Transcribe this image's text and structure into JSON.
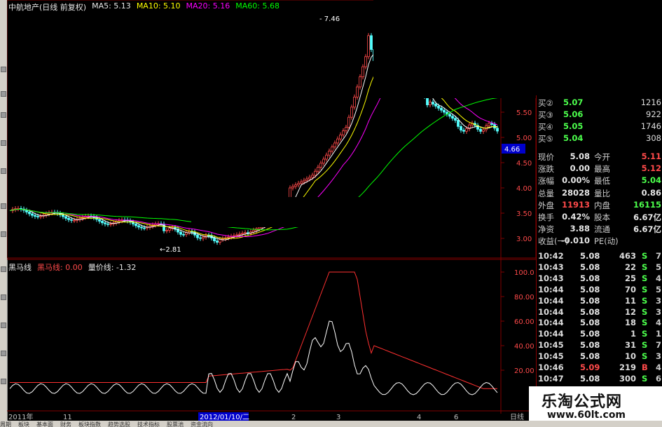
{
  "title": {
    "stock": "中航地产(日线 前复权)",
    "ma5": "MA5: 5.13",
    "ma10": "MA10: 5.10",
    "ma20": "MA20: 5.16",
    "ma60": "MA60: 5.68"
  },
  "indicator": {
    "name": "黑马线",
    "heima": "黑马线: 0.00",
    "liangjia": "量价线: -1.32"
  },
  "price_axis": [
    "5.50",
    "5.00",
    "4.50",
    "4.00",
    "3.50",
    "3.00"
  ],
  "current_price_tag": "4.66",
  "indicator_axis": [
    "100.0",
    "80.00",
    "60.00",
    "40.00",
    "20.00"
  ],
  "annotations": {
    "high": "7.46",
    "low": "2.81"
  },
  "x_labels": {
    "year": "2011年",
    "m11": "11",
    "cursor_date": "2012/01/10/二",
    "m2": "2",
    "m3": "3",
    "m4": "4",
    "m6": "6",
    "period": "日线"
  },
  "order_book": [
    {
      "label": "买②",
      "price": "5.07",
      "vol": "1216"
    },
    {
      "label": "买③",
      "price": "5.06",
      "vol": "922"
    },
    {
      "label": "买④",
      "price": "5.05",
      "vol": "1746"
    },
    {
      "label": "买⑤",
      "price": "5.04",
      "vol": "308"
    }
  ],
  "stats": [
    {
      "l1": "现价",
      "v1": "5.08",
      "c1": "#e6e6e6",
      "l2": "今开",
      "v2": "5.11",
      "c2": "#ff4a4a"
    },
    {
      "l1": "涨跌",
      "v1": "0.00",
      "c1": "#e6e6e6",
      "l2": "最高",
      "v2": "5.12",
      "c2": "#ff4a4a"
    },
    {
      "l1": "涨幅",
      "v1": "0.00%",
      "c1": "#e6e6e6",
      "l2": "最低",
      "v2": "5.04",
      "c2": "#4cff4c"
    },
    {
      "l1": "总量",
      "v1": "28028",
      "c1": "#e6e6e6",
      "l2": "量比",
      "v2": "0.86",
      "c2": "#e6e6e6"
    },
    {
      "l1": "外盘",
      "v1": "11913",
      "c1": "#ff4a4a",
      "l2": "内盘",
      "v2": "16115",
      "c2": "#4cff4c"
    },
    {
      "l1": "换手",
      "v1": "0.42%",
      "c1": "#e6e6e6",
      "l2": "股本",
      "v2": "6.67亿",
      "c2": "#e6e6e6"
    },
    {
      "l1": "净资",
      "v1": "3.88",
      "c1": "#e6e6e6",
      "l2": "流通",
      "v2": "6.67亿",
      "c2": "#e6e6e6"
    },
    {
      "l1": "收益(一)",
      "v1": "-0.010",
      "c1": "#e6e6e6",
      "l2": "PE(动)",
      "v2": "",
      "c2": "#e6e6e6"
    }
  ],
  "ticks": [
    {
      "time": "10:42",
      "price": "5.08",
      "vol": "463",
      "side": "S",
      "num": "7",
      "pc": "#e6e6e6",
      "sc": "#4cff4c"
    },
    {
      "time": "10:43",
      "price": "5.08",
      "vol": "22",
      "side": "S",
      "num": "5",
      "pc": "#e6e6e6",
      "sc": "#4cff4c"
    },
    {
      "time": "10:43",
      "price": "5.08",
      "vol": "25",
      "side": "S",
      "num": "4",
      "pc": "#e6e6e6",
      "sc": "#4cff4c"
    },
    {
      "time": "10:44",
      "price": "5.08",
      "vol": "70",
      "side": "S",
      "num": "5",
      "pc": "#e6e6e6",
      "sc": "#4cff4c"
    },
    {
      "time": "10:44",
      "price": "5.08",
      "vol": "11",
      "side": "S",
      "num": "3",
      "pc": "#e6e6e6",
      "sc": "#4cff4c"
    },
    {
      "time": "10:44",
      "price": "5.08",
      "vol": "12",
      "side": "S",
      "num": "3",
      "pc": "#e6e6e6",
      "sc": "#4cff4c"
    },
    {
      "time": "10:44",
      "price": "5.08",
      "vol": "18",
      "side": "S",
      "num": "4",
      "pc": "#e6e6e6",
      "sc": "#4cff4c"
    },
    {
      "time": "10:44",
      "price": "5.08",
      "vol": "1",
      "side": "S",
      "num": "1",
      "pc": "#e6e6e6",
      "sc": "#4cff4c"
    },
    {
      "time": "10:45",
      "price": "5.08",
      "vol": "31",
      "side": "S",
      "num": "7",
      "pc": "#e6e6e6",
      "sc": "#4cff4c"
    },
    {
      "time": "10:45",
      "price": "5.08",
      "vol": "10",
      "side": "S",
      "num": "3",
      "pc": "#e6e6e6",
      "sc": "#4cff4c"
    },
    {
      "time": "10:46",
      "price": "5.09",
      "vol": "219",
      "side": "B",
      "num": "4",
      "pc": "#ff4a4a",
      "sc": "#ff4a4a"
    },
    {
      "time": "10:47",
      "price": "5.08",
      "vol": "300",
      "side": "S",
      "num": "6",
      "pc": "#e6e6e6",
      "sc": "#4cff4c"
    }
  ],
  "watermark": {
    "name": "乐淘公式网",
    "url": "www.60lt.com"
  },
  "tabs": [
    "周期",
    "板块",
    "基本面",
    "财务",
    "板块指数",
    "趋势选股",
    "技术指标",
    "股票池",
    "资金流向"
  ],
  "colors": {
    "up": "#ff4a4a",
    "down": "#4cff4c",
    "ma5": "#ffffff",
    "ma10": "#ffff00",
    "ma20": "#ff00ff",
    "ma60": "#00ff00",
    "heima": "#ff3030",
    "liangjia": "#ffffff",
    "grid": "#800000"
  }
}
